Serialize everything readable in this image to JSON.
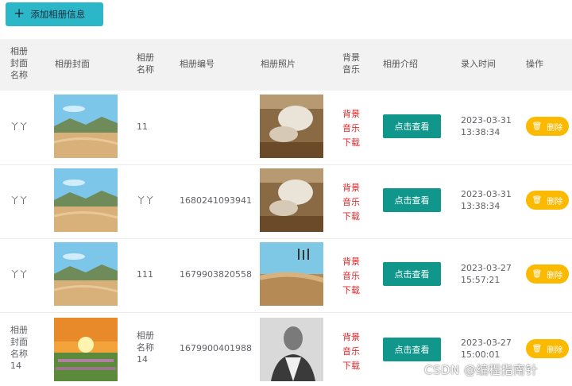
{
  "toolbar": {
    "add_label": "添加相册信息"
  },
  "columns": {
    "cover_name": [
      "相册",
      "封面",
      "名称"
    ],
    "cover": "相册封面",
    "name": [
      "相册",
      "名称"
    ],
    "number": "相册编号",
    "photo": "相册照片",
    "music": [
      "背景",
      "音乐"
    ],
    "intro": "相册介绍",
    "time": "录入时间",
    "ops": "操作"
  },
  "rows": [
    {
      "cover_name": [
        "丫丫"
      ],
      "name": [
        "11"
      ],
      "number": "",
      "music": [
        "背景",
        "音乐",
        "下载"
      ],
      "intro_btn": "点击查看",
      "time": [
        "2023-03-31",
        "13:38:34"
      ],
      "delete": "删除"
    },
    {
      "cover_name": [
        "丫丫"
      ],
      "name": [
        "丫丫"
      ],
      "number": "1680241093941",
      "music": [
        "背景",
        "音乐",
        "下载"
      ],
      "intro_btn": "点击查看",
      "time": [
        "2023-03-31",
        "13:38:34"
      ],
      "delete": "删除"
    },
    {
      "cover_name": [
        "丫丫"
      ],
      "name": [
        "111"
      ],
      "number": "1679903820558",
      "music": [
        "背景",
        "音乐",
        "下载"
      ],
      "intro_btn": "点击查看",
      "time": [
        "2023-03-27",
        "15:57:21"
      ],
      "delete": "删除"
    },
    {
      "cover_name": [
        "相册",
        "封面",
        "名称",
        "14"
      ],
      "name": [
        "相册",
        "名称",
        "14"
      ],
      "number": "1679900401988",
      "music": [
        "背景",
        "音乐",
        "下载"
      ],
      "intro_btn": "点击查看",
      "time": [
        "2023-03-27",
        "15:00:01"
      ],
      "delete": "删除"
    }
  ],
  "watermark": "CSDN @编程指南针",
  "colors": {
    "add_button": "#2cb7c9",
    "view_button": "#10968a",
    "delete_button": "#fbb900",
    "music_link": "#e8262a",
    "header_bg": "#f2f2f2"
  },
  "icons": {
    "add": "plus-icon",
    "delete": "trash-icon"
  }
}
